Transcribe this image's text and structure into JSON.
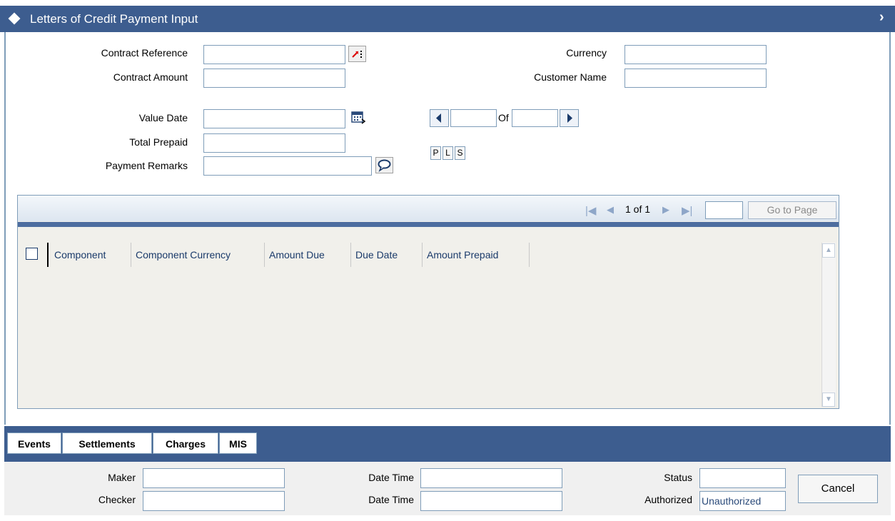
{
  "window": {
    "title": "Letters of Credit Payment Input"
  },
  "form": {
    "contract_reference_label": "Contract Reference",
    "contract_amount_label": "Contract Amount",
    "currency_label": "Currency",
    "customer_name_label": "Customer Name",
    "value_date_label": "Value Date",
    "total_prepaid_label": "Total Prepaid",
    "payment_remarks_label": "Payment Remarks"
  },
  "record_nav": {
    "of_label": "Of"
  },
  "psl_buttons": [
    "P",
    "L",
    "S"
  ],
  "grid": {
    "pagination_text": "1 of 1",
    "goto_page_label": "Go to Page",
    "columns": [
      "Component",
      "Component Currency",
      "Amount Due",
      "Due Date",
      "Amount Prepaid"
    ]
  },
  "tabs": [
    "Events",
    "Settlements",
    "Charges",
    "MIS"
  ],
  "footer": {
    "maker_label": "Maker",
    "checker_label": "Checker",
    "date_time_label_1": "Date Time",
    "date_time_label_2": "Date Time",
    "status_label": "Status",
    "authorized_label": "Authorized",
    "authorized_value": "Unauthorized",
    "cancel_label": "Cancel"
  },
  "icons": {
    "title": "diamond-icon",
    "close": "close-icon",
    "contract_lookup": "lookup-icon",
    "calendar": "calendar-icon",
    "remarks": "speech-bubble-icon"
  }
}
